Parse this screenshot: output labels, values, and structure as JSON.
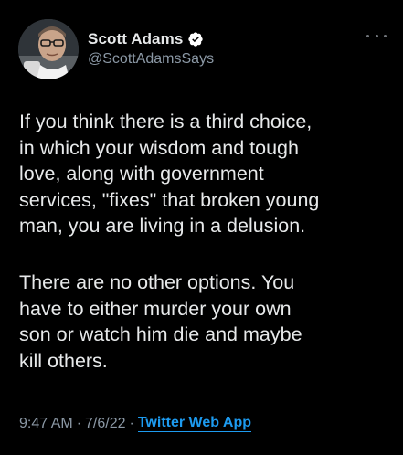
{
  "tweet": {
    "author": {
      "display_name": "Scott Adams",
      "handle": "@ScottAdamsSays",
      "verified": true
    },
    "more_icon": "more-horizontal-icon",
    "paragraphs": [
      "If you think there is a third choice,\nin which your wisdom and tough\nlove, along with government\nservices, \"fixes\" that broken young\nman, you are living in a delusion.",
      "There are no other options. You\nhave to either murder your own\nson or watch him die and maybe\nkill others."
    ],
    "meta": {
      "time": "9:47 AM",
      "separator": "·",
      "date": "7/6/22",
      "source": "Twitter Web App"
    }
  },
  "colors": {
    "background": "#000000",
    "text": "#e7e9ea",
    "secondary": "#8b98a5",
    "link": "#1d9bf0"
  }
}
